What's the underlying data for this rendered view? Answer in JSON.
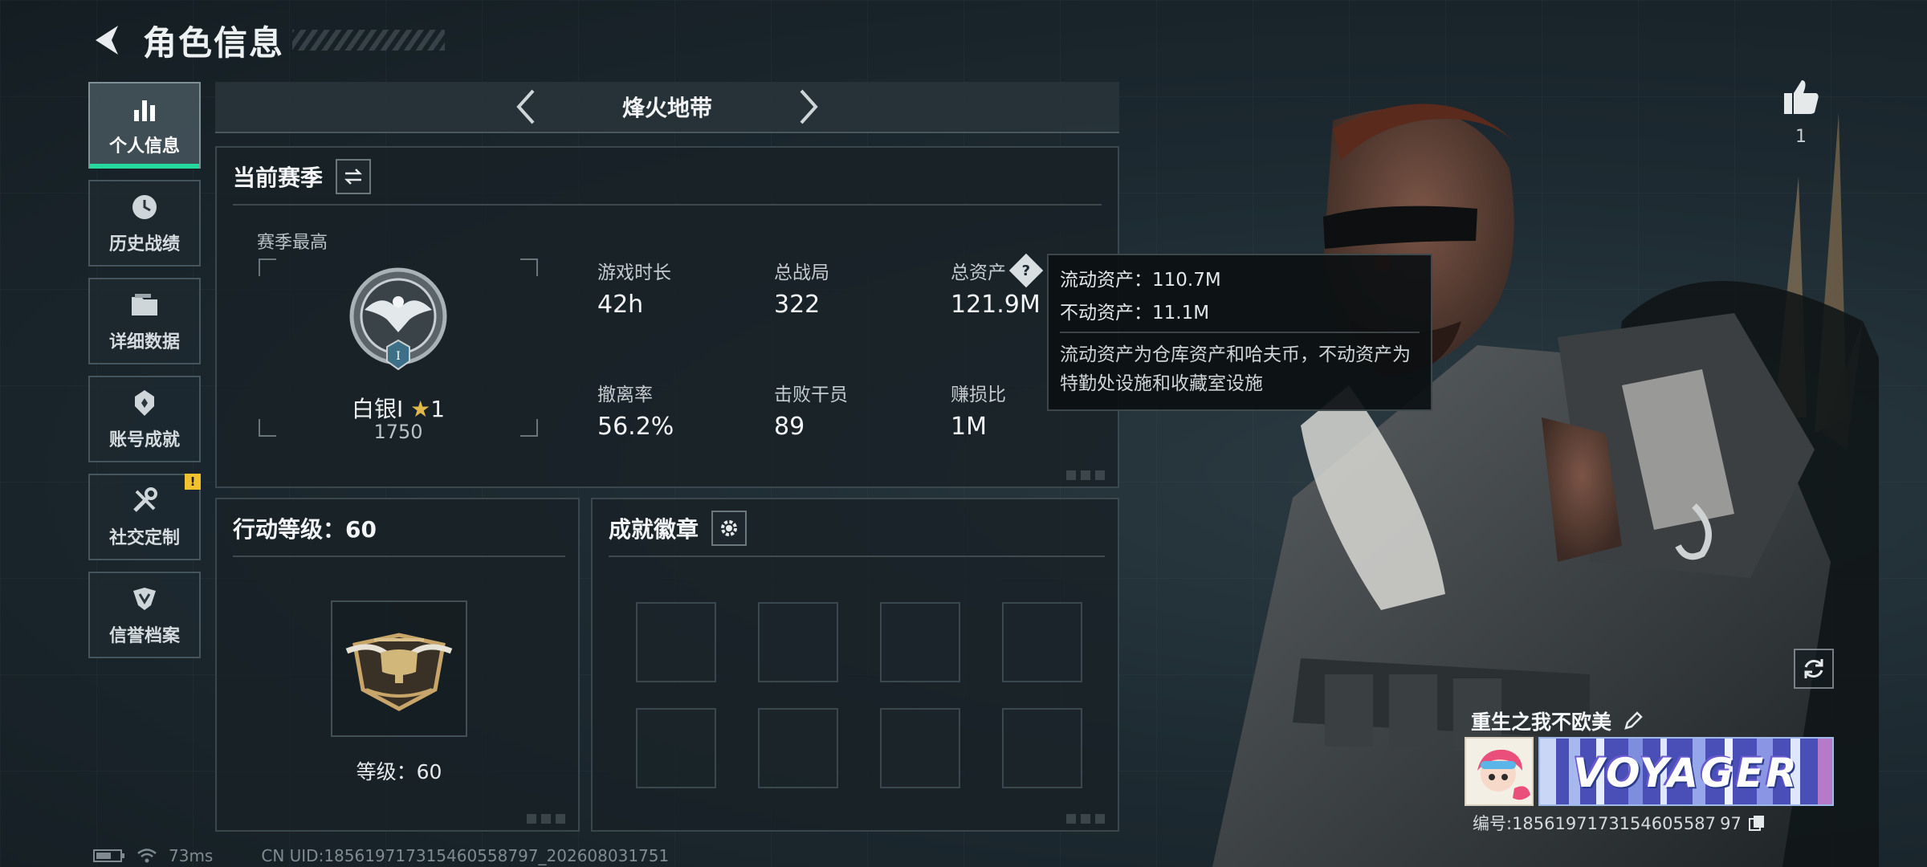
{
  "header": {
    "title": "角色信息"
  },
  "nav": {
    "items": [
      {
        "label": "个人信息",
        "icon": "bar-chart-icon",
        "active": true
      },
      {
        "label": "历史战绩",
        "icon": "history-icon"
      },
      {
        "label": "详细数据",
        "icon": "folder-icon"
      },
      {
        "label": "账号成就",
        "icon": "achievement-icon"
      },
      {
        "label": "社交定制",
        "icon": "tools-icon",
        "badge": "!"
      },
      {
        "label": "信誉档案",
        "icon": "credit-icon"
      }
    ]
  },
  "mode": {
    "title": "烽火地带"
  },
  "season": {
    "title": "当前赛季",
    "best_label": "赛季最高",
    "rank_name": "白银I",
    "rank_stars": "1",
    "rank_score": "1750",
    "stats": [
      {
        "label": "游戏时长",
        "value": "42h"
      },
      {
        "label": "总战局",
        "value": "322"
      },
      {
        "label": "总资产",
        "value": "121.9M"
      },
      {
        "label": "撤离率",
        "value": "56.2%"
      },
      {
        "label": "击败干员",
        "value": "89"
      },
      {
        "label": "赚损比",
        "value": "1M"
      }
    ]
  },
  "tooltip": {
    "liquid": "流动资产：110.7M",
    "fixed": "不动资产：11.1M",
    "desc": "流动资产为仓库资产和哈夫币，不动资产为特勤处设施和收藏室设施"
  },
  "level": {
    "title": "行动等级：60",
    "label": "等级：60"
  },
  "achievements": {
    "title": "成就徽章"
  },
  "profile": {
    "likes": "1",
    "name": "重生之我不欧美",
    "nameplate_text": "VOYAGER",
    "id": "编号:1856197173154605587 97"
  },
  "status": {
    "ping": "73ms",
    "uid": "CN UID:185619717315460558797_202608031751"
  },
  "colors": {
    "accent": "#26d89b",
    "badge": "#f2c12e",
    "star": "#e1b84a"
  }
}
